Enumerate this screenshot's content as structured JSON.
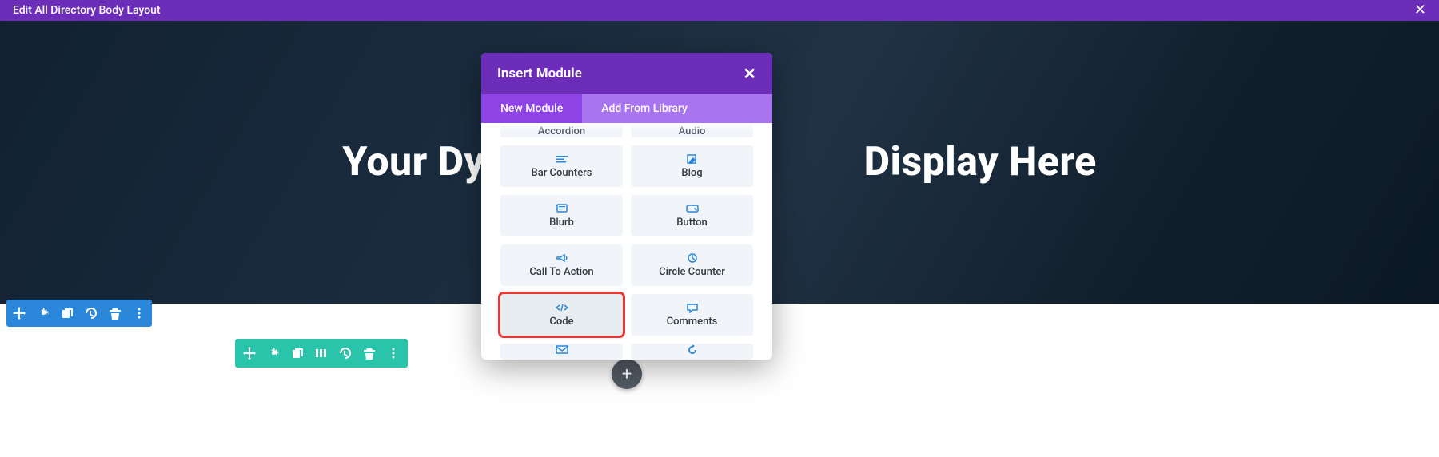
{
  "topbar": {
    "title": "Edit All Directory Body Layout"
  },
  "hero": {
    "title_full": "Your Dynamic Content Will Display Here",
    "title_left": "Your Dynami",
    "title_right": "Display Here"
  },
  "section_toolbar": {
    "icons": [
      "move",
      "settings",
      "duplicate",
      "save",
      "delete",
      "more"
    ]
  },
  "row_toolbar": {
    "icons": [
      "move",
      "settings",
      "duplicate",
      "columns",
      "save",
      "delete",
      "more"
    ]
  },
  "modal": {
    "title": "Insert Module",
    "tabs": {
      "new": "New Module",
      "library": "Add From Library"
    },
    "items_partial_top": [
      {
        "label": "Accordion"
      },
      {
        "label": "Audio"
      }
    ],
    "items": [
      {
        "label": "Bar Counters",
        "icon": "bars"
      },
      {
        "label": "Blog",
        "icon": "edit"
      },
      {
        "label": "Blurb",
        "icon": "blurb"
      },
      {
        "label": "Button",
        "icon": "button"
      },
      {
        "label": "Call To Action",
        "icon": "megaphone"
      },
      {
        "label": "Circle Counter",
        "icon": "circle"
      },
      {
        "label": "Code",
        "icon": "code",
        "highlighted": true
      },
      {
        "label": "Comments",
        "icon": "comment"
      }
    ],
    "items_partial_bottom": [
      {
        "icon": "mail"
      },
      {
        "icon": "rotate"
      }
    ]
  }
}
